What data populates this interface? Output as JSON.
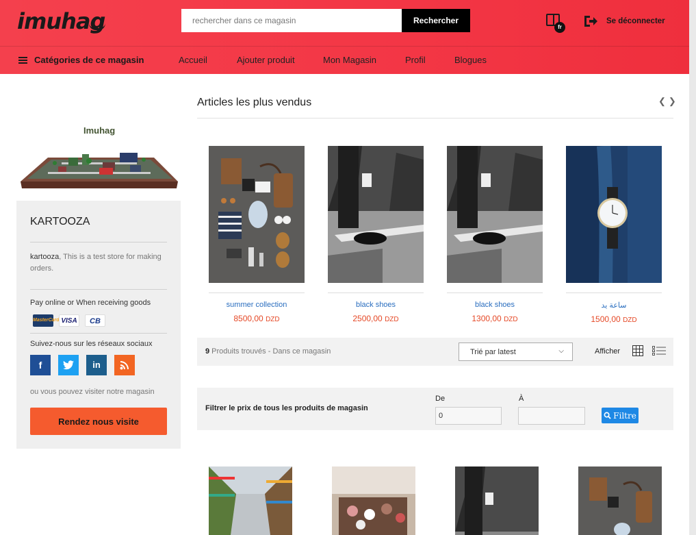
{
  "header": {
    "logo": "imuhag",
    "search_placeholder": "rechercher dans ce magasin",
    "search_button": "Rechercher",
    "lang_code": "fr",
    "logout_label": "Se déconnecter"
  },
  "nav": {
    "categories_label": "Catégories de ce magasin",
    "links": [
      "Accueil",
      "Ajouter produit",
      "Mon Magasin",
      "Profil",
      "Blogues"
    ]
  },
  "store": {
    "banner_text": "Imuhag",
    "name": "KARTOOZA",
    "desc_owner": "kartooza",
    "desc_text": ", This is a test store for making orders.",
    "payment_title": "Pay online or When receiving goods",
    "payment_methods": [
      "MasterCard",
      "VISA",
      "CB"
    ],
    "social_title": "Suivez-nous sur les réseaux sociaux",
    "social_icons": [
      "f",
      "t",
      "in",
      "rss"
    ],
    "visit_text": "ou vous pouvez visiter notre magasin",
    "visit_button": "Rendez nous visite"
  },
  "best_sellers": {
    "title": "Articles les plus vendus",
    "products": [
      {
        "name": "summer collection",
        "price": "8500,00",
        "currency": "DZD"
      },
      {
        "name": "black shoes",
        "price": "2500,00",
        "currency": "DZD"
      },
      {
        "name": "black shoes",
        "price": "1300,00",
        "currency": "DZD"
      },
      {
        "name": "ساعة يد",
        "price": "1500,00",
        "currency": "DZD"
      }
    ]
  },
  "toolbar": {
    "count": "9",
    "found_text": " Produits trouvés - Dans ce magasin",
    "sort_label": "Trié par latest",
    "afficher": "Afficher"
  },
  "filter": {
    "label": "Filtrer le prix de tous les produits de magasin",
    "from_label": "De",
    "to_label": "À",
    "from_value": "0",
    "to_value": "",
    "button": "Filtre"
  },
  "colors": {
    "header_red": "#f33645",
    "link_blue": "#2a6ebf",
    "price_red": "#e54826",
    "visit_orange": "#f55b2e",
    "filter_blue": "#1e88e5"
  }
}
